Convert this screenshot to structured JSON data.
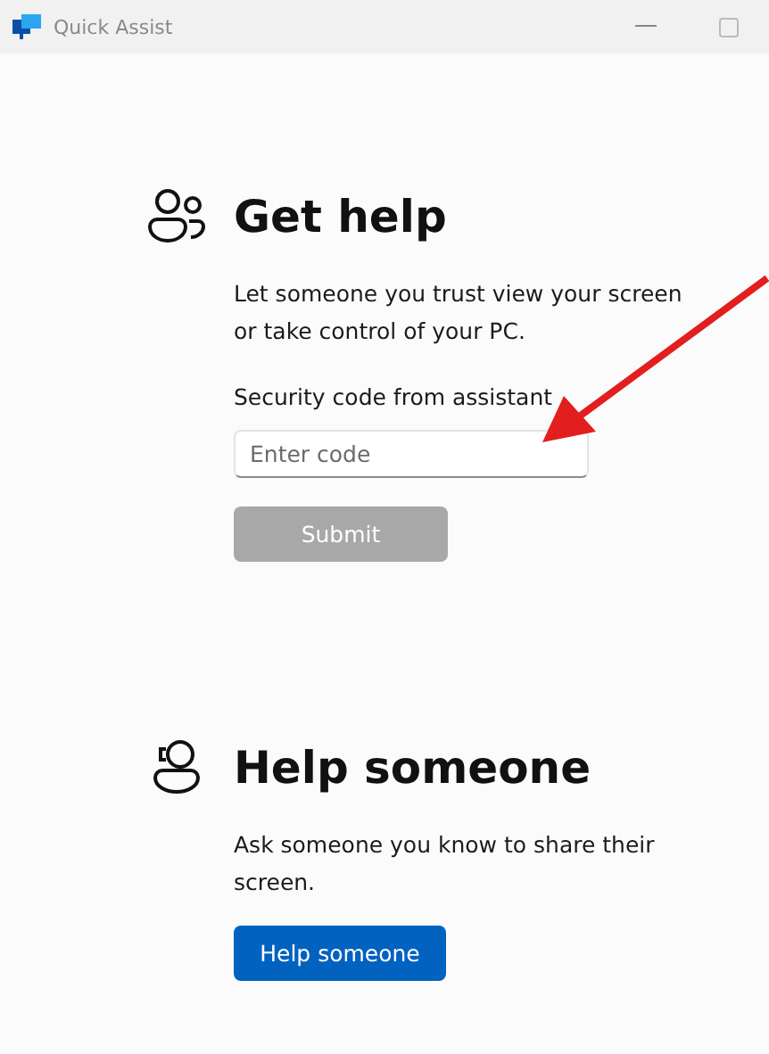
{
  "window": {
    "title": "Quick Assist"
  },
  "sections": [
    {
      "kind": "people",
      "heading": "Get help",
      "description": "Let someone you trust view your screen or take control of your PC.",
      "field": {
        "label": "Security code from assistant",
        "placeholder": "Enter code"
      },
      "button": {
        "label": "Submit",
        "disabled": true
      }
    },
    {
      "kind": "helper",
      "heading": "Help someone",
      "description": "Ask someone you know to share their screen.",
      "button": {
        "label": "Help someone",
        "disabled": false
      }
    }
  ]
}
